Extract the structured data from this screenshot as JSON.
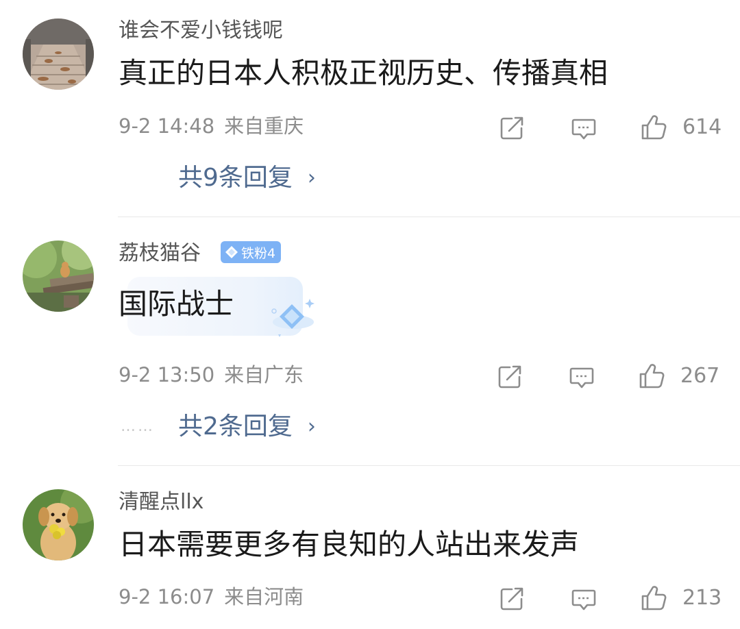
{
  "comments": [
    {
      "username": "谁会不爱小钱钱呢",
      "content": "真正的日本人积极正视历史、传播真相",
      "time": "9-2 14:48",
      "location": "来自重庆",
      "likes": "614",
      "replies_label": "共9条回复",
      "avatar_icon": "autumn-leaves-boardwalk"
    },
    {
      "username": "荔枝猫谷",
      "badge": "铁粉4",
      "content": "国际战士",
      "time": "9-2 13:50",
      "location": "来自广东",
      "likes": "267",
      "more_dots": "……",
      "replies_label": "共2条回复",
      "avatar_icon": "cat-on-wooden-fence"
    },
    {
      "username": "清醒点llx",
      "content": "日本需要更多有良知的人站出来发声",
      "time": "9-2 16:07",
      "location": "来自河南",
      "likes": "213",
      "avatar_icon": "golden-retriever-puppy-with-flowers"
    }
  ],
  "icons": {
    "share": "share-icon",
    "comment": "comment-icon",
    "like": "thumbs-up-icon",
    "chevron": "chevron-right-icon"
  },
  "colors": {
    "reply_link": "#4f6a8f",
    "meta_text": "#8c8c8c",
    "badge_bg": "#7db2f5"
  }
}
